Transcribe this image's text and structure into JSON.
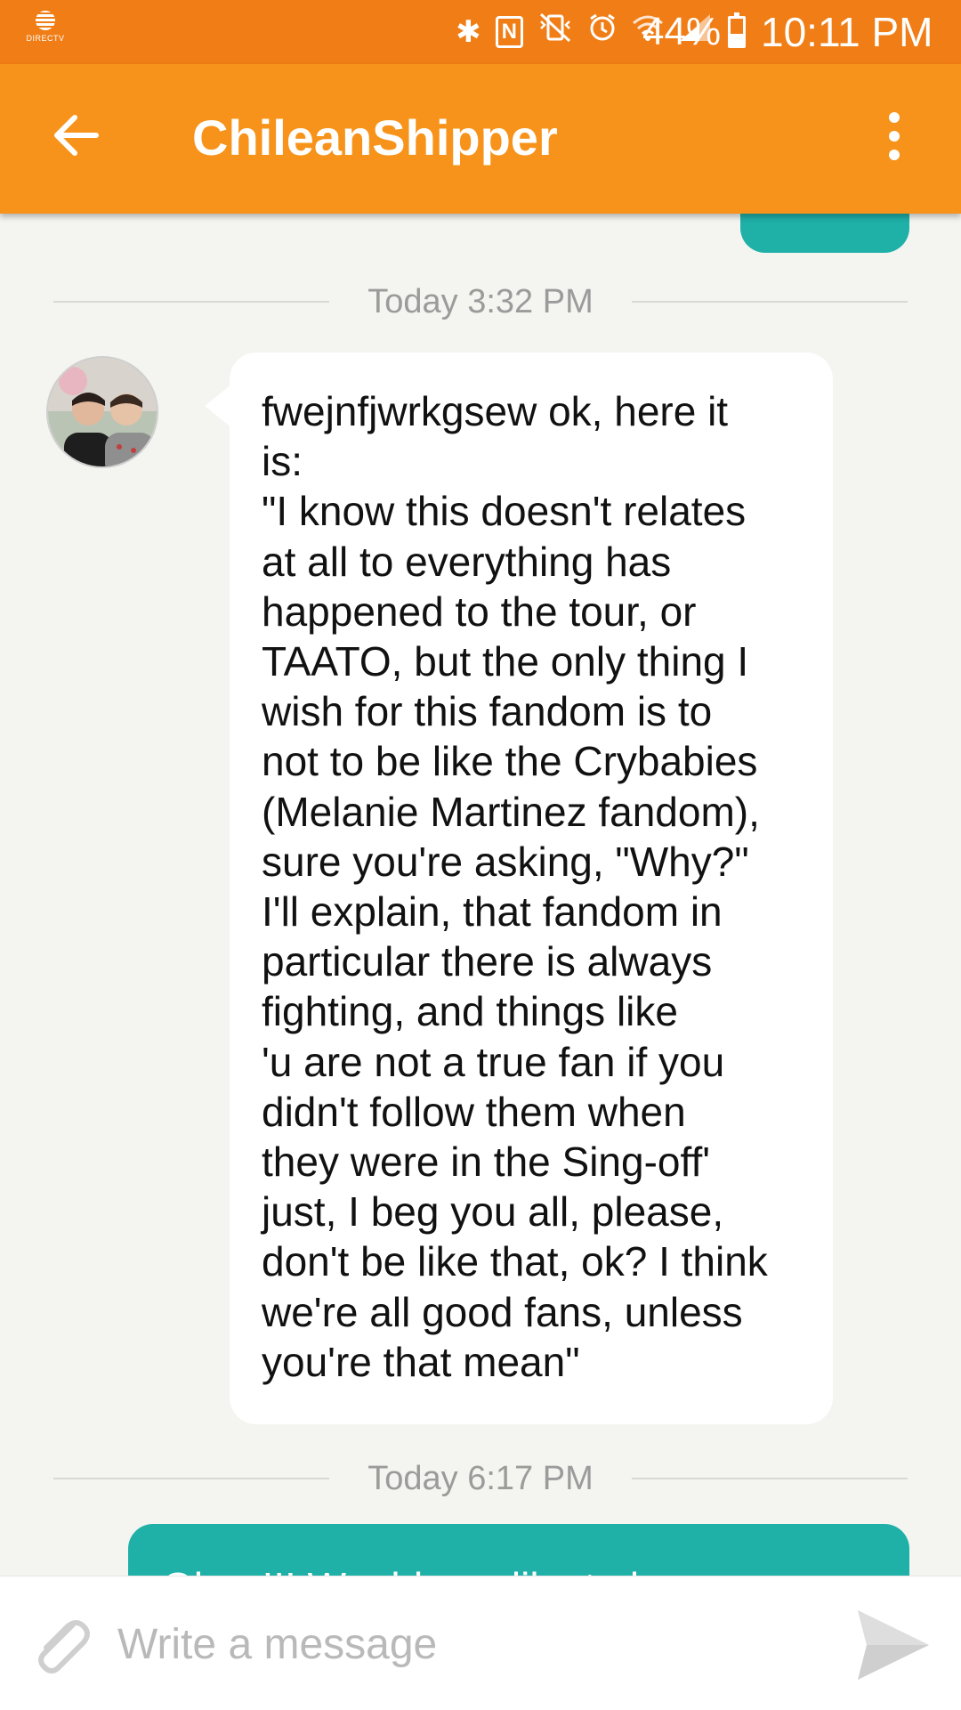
{
  "status_bar": {
    "carrier": "DIRECTV",
    "battery": "44%",
    "battery_level": 0.44,
    "time": "10:11 PM",
    "icons": [
      "bluetooth-icon",
      "nfc-icon",
      "vibrate-mute-icon",
      "alarm-icon",
      "wifi-icon",
      "signal-icon",
      "battery-icon"
    ]
  },
  "app_bar": {
    "title": "ChileanShipper",
    "back_icon": "arrow-left-icon",
    "menu_icon": "more-vert-icon"
  },
  "conversation": {
    "dividers": [
      {
        "timestamp": "Today 3:32 PM"
      },
      {
        "timestamp": "Today 6:17 PM"
      }
    ],
    "received_message": "fwejnfjwrkgsew ok, here it\nis:\n\"I know this doesn't relates\nat all to everything has\nhappened to the tour, or\nTAATO, but the only thing I\nwish for this fandom is to\nnot to be like the Crybabies\n(Melanie Martinez fandom),\nsure you're asking, \"Why?\"\nI'll explain, that fandom in\nparticular there is always\nfighting, and things like\n'u are not a true fan if you\ndidn't follow them when\nthey were in the Sing-off'\njust, I beg you all, please,\ndon't be like that, ok? I think\nwe're all good fans, unless\nyou're that mean\"",
    "sent_bottom_peek": "Oh... !!! Would you like to be"
  },
  "composer": {
    "placeholder": "Write a message",
    "value": "",
    "attach_icon": "paperclip-icon",
    "send_icon": "send-icon"
  },
  "colors": {
    "status_bar": "#f07d15",
    "app_bar": "#f7931a",
    "sent_bubble": "#1fb0a8",
    "received_bubble": "#ffffff",
    "background": "#f4f4f0"
  }
}
